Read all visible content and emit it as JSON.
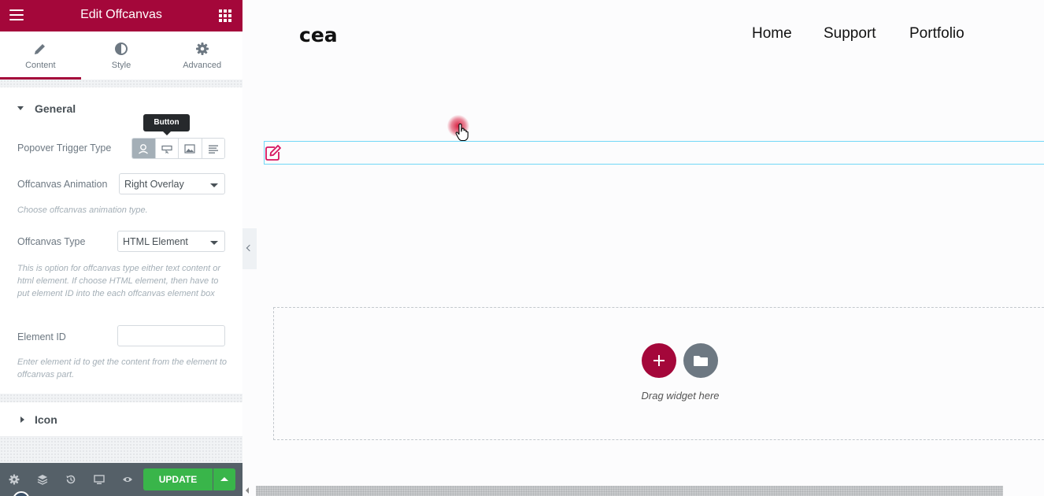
{
  "panel": {
    "title": "Edit Offcanvas",
    "tabs": [
      {
        "label": "Content",
        "icon": "pencil-icon"
      },
      {
        "label": "Style",
        "icon": "half-circle-icon"
      },
      {
        "label": "Advanced",
        "icon": "gear-icon"
      }
    ],
    "sections": {
      "general": {
        "title": "General",
        "expanded": true
      },
      "icon": {
        "title": "Icon",
        "expanded": false
      }
    },
    "fields": {
      "trigger_type": {
        "label": "Popover Trigger Type",
        "tooltip": "Button",
        "options": [
          "user-icon",
          "button-icon",
          "image-icon",
          "text-icon"
        ],
        "selected_index": 0
      },
      "animation": {
        "label": "Offcanvas Animation",
        "value": "Right Overlay",
        "help": "Choose offcanvas animation type."
      },
      "type": {
        "label": "Offcanvas Type",
        "value": "HTML Element",
        "help": "This is option for offcanvas type either text content or html element. If choose HTML element, then have to put element ID into the each offcanvas element box"
      },
      "element_id": {
        "label": "Element ID",
        "value": "",
        "help": "Enter element id to get the content from the element to offcanvas part."
      }
    },
    "footer": {
      "icons": [
        "settings-icon",
        "layers-icon",
        "history-icon",
        "responsive-icon",
        "preview-eye-icon"
      ],
      "update_label": "UPDATE"
    },
    "colors": {
      "brand": "#a4073a",
      "update": "#39b54a",
      "footer": "#556068"
    }
  },
  "preview": {
    "logo": "cea",
    "nav": [
      "Home",
      "Support",
      "Portfolio"
    ],
    "drop_zone_text": "Drag widget here"
  }
}
